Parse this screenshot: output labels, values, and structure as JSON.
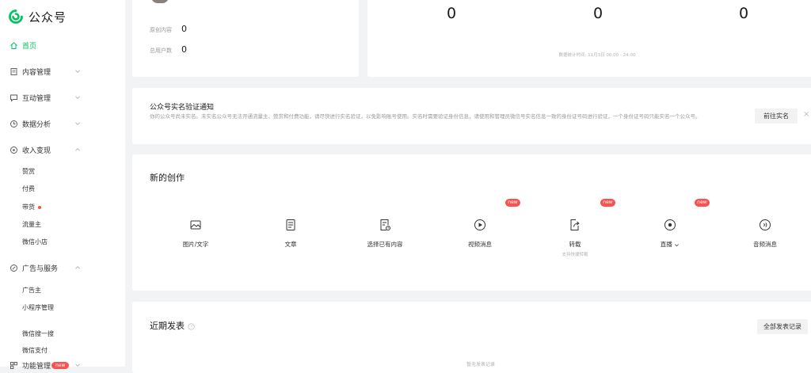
{
  "app": {
    "name": "公众号"
  },
  "sidebar": {
    "items": [
      {
        "label": "首页",
        "icon": "home-icon",
        "active": true
      },
      {
        "label": "内容管理",
        "icon": "document-icon"
      },
      {
        "label": "互动管理",
        "icon": "chat-icon"
      },
      {
        "label": "数据分析",
        "icon": "chart-icon"
      },
      {
        "label": "收入变现",
        "icon": "money-icon"
      },
      {
        "label": "广告与服务",
        "icon": "ad-icon"
      },
      {
        "label": "功能管理",
        "icon": "function-icon"
      }
    ],
    "income_sub": [
      "赞赏",
      "付费",
      "带货",
      "流量主",
      "微信小店"
    ],
    "ads_sub": [
      "广告主",
      "小程序管理"
    ],
    "extra_sub": [
      "微信搜一搜",
      "微信支付"
    ],
    "badge_new": "new"
  },
  "account": {
    "original_label": "原创内容",
    "original_value": "0",
    "users_label": "总用户数",
    "users_value": "0"
  },
  "stats": {
    "values": [
      "0",
      "0",
      "0"
    ],
    "footnote": "数据统计时间: 11月3日 00:00 - 24:00"
  },
  "notice": {
    "title": "公众号实名验证通知",
    "description": "你的公众号尚未实名。未实名公众号无法开通流量主、赞赏和付费功能，请尽快进行实名验证，以免影响账号使用。实名时需要验证身份信息，请使用和管理员微信号实名信息一致的身份证号码进行验证，一个身份证号码只能实名一个公众号。",
    "button": "前往实名",
    "close_icon": "×"
  },
  "create": {
    "title": "新的创作",
    "items": [
      {
        "label": "图片/文字",
        "icon": "image-text-icon"
      },
      {
        "label": "文章",
        "icon": "article-icon"
      },
      {
        "label": "选择已有内容",
        "icon": "existing-content-icon"
      },
      {
        "label": "视频消息",
        "icon": "video-icon",
        "tag": "new"
      },
      {
        "label": "转载",
        "icon": "repost-icon",
        "tag": "new",
        "sub": "支持快捷转载"
      },
      {
        "label": "直播",
        "icon": "live-icon",
        "tag": "new"
      },
      {
        "label": "音频消息",
        "icon": "audio-icon"
      }
    ]
  },
  "recent": {
    "title": "近期发表",
    "button": "全部发表记录",
    "empty": "暂无发表记录"
  },
  "colors": {
    "accent": "#07c160",
    "badge": "#fa5151",
    "page_bg": "#f2f3f5"
  }
}
